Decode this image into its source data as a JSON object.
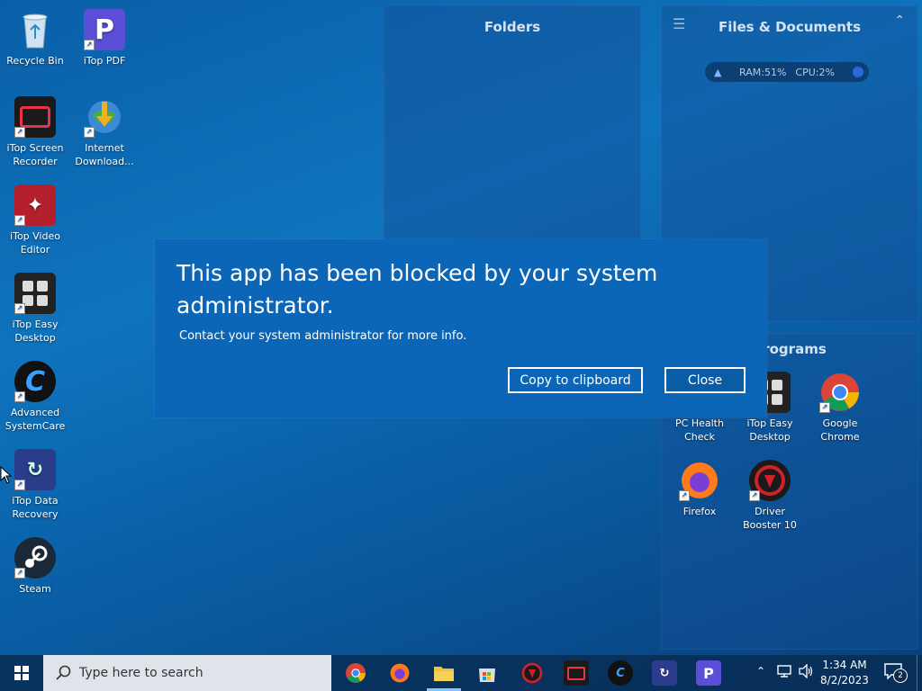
{
  "desktop": {
    "icons": [
      {
        "label": "Recycle Bin",
        "icon": "recycle-bin-icon"
      },
      {
        "label": "iTop PDF",
        "icon": "itop-pdf-icon"
      },
      {
        "label": "iTop Screen Recorder",
        "icon": "itop-screen-recorder-icon"
      },
      {
        "label": "Internet Download...",
        "icon": "internet-download-manager-icon"
      },
      {
        "label": "iTop Video Editor",
        "icon": "itop-video-editor-icon"
      },
      {
        "label": "iTop Easy Desktop",
        "icon": "itop-easy-desktop-icon"
      },
      {
        "label": "Advanced SystemCare",
        "icon": "advanced-systemcare-icon"
      },
      {
        "label": "iTop Data Recovery",
        "icon": "itop-data-recovery-icon"
      },
      {
        "label": "Steam",
        "icon": "steam-icon"
      }
    ]
  },
  "folders_panel": {
    "title": "Folders"
  },
  "files_panel": {
    "title": "Files & Documents",
    "ram": "RAM:51%",
    "cpu": "CPU:2%"
  },
  "programs_panel": {
    "title": "Programs",
    "icons": [
      {
        "label": "PC Health Check",
        "icon": "pc-health-check-icon"
      },
      {
        "label": "iTop Easy Desktop",
        "icon": "itop-easy-desktop-icon"
      },
      {
        "label": "Google Chrome",
        "icon": "chrome-icon"
      },
      {
        "label": "Firefox",
        "icon": "firefox-icon"
      },
      {
        "label": "Driver Booster 10",
        "icon": "driver-booster-icon"
      }
    ]
  },
  "dialog": {
    "title": "This app has been blocked by your system administrator.",
    "message": "Contact your system administrator for more info.",
    "copy_label": "Copy to clipboard",
    "close_label": "Close"
  },
  "taskbar": {
    "search_placeholder": "Type here to search",
    "time": "1:34 AM",
    "date": "8/2/2023",
    "notification_count": "2",
    "apps": [
      "chrome-icon",
      "firefox-icon",
      "file-explorer-icon",
      "microsoft-store-icon",
      "driver-booster-icon",
      "itop-screen-recorder-icon",
      "advanced-systemcare-icon",
      "itop-data-recovery-icon",
      "itop-pdf-icon"
    ]
  },
  "colors": {
    "dialog": "#0b66b8",
    "taskbar": "#082d55",
    "desktop": "#0e74bd"
  }
}
